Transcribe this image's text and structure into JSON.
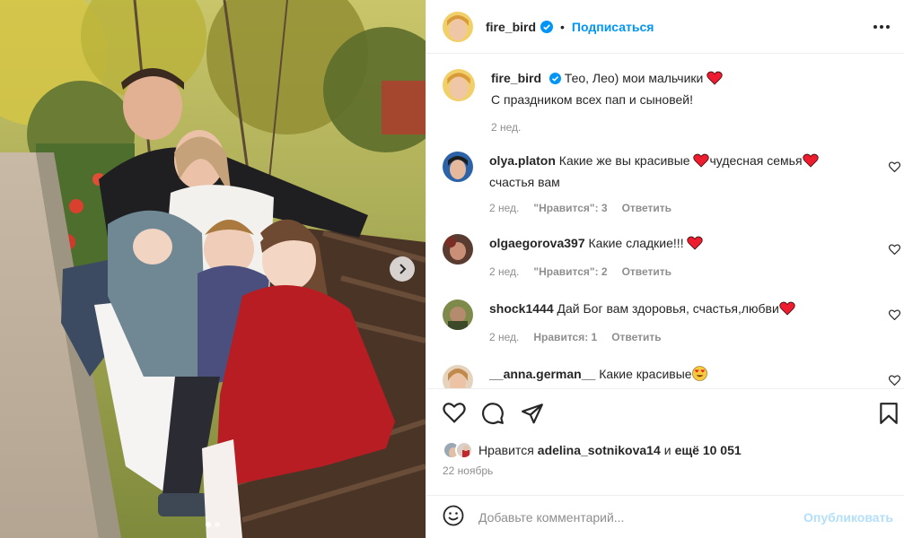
{
  "post": {
    "author": "fire_bird",
    "follow_label": "Подписаться",
    "separator": "•",
    "caption_line1": "Тео, Лео) мои мальчики",
    "caption_line2": "С праздником всех пап и сыновей!",
    "caption_time": "2 нед."
  },
  "comments": [
    {
      "username": "olya.platon",
      "text_part1": "Какие же вы красивые",
      "text_part2": "чудесная семья",
      "text_line2": "счастья вам",
      "time": "2 нед.",
      "likes": "\"Нравится\": 3",
      "reply": "Ответить"
    },
    {
      "username": "olgaegorova397",
      "text": "Какие сладкие!!!",
      "time": "2 нед.",
      "likes": "\"Нравится\": 2",
      "reply": "Ответить"
    },
    {
      "username": "shock1444",
      "text": "Дай Бог вам здоровья, счастья,любви",
      "time": "2 нед.",
      "likes": "Нравится: 1",
      "reply": "Ответить"
    },
    {
      "username": "__anna.german__",
      "text": "Какие красивые"
    }
  ],
  "likes": {
    "prefix": "Нравится",
    "user": "adelina_sotnikova14",
    "middle": "и",
    "others": "ещё 10 051"
  },
  "date": "22 ноябрь",
  "composer": {
    "placeholder": "Добавьте комментарий...",
    "publish_label": "Опубликовать"
  },
  "icons": {
    "verified": "verified-badge-icon",
    "like": "heart-icon",
    "comment": "comment-bubble-icon",
    "share": "paper-plane-icon",
    "save": "bookmark-icon",
    "emoji": "smiley-icon",
    "next": "chevron-right-icon",
    "more": "more-dots-icon"
  },
  "colors": {
    "accent": "#0095f6",
    "verified": "#0095f6",
    "heart": "#ed1d2f",
    "publish_disabled": "#b2dffc",
    "muted": "#8e8e8e"
  },
  "carousel": {
    "slides": 2,
    "current": 1
  }
}
